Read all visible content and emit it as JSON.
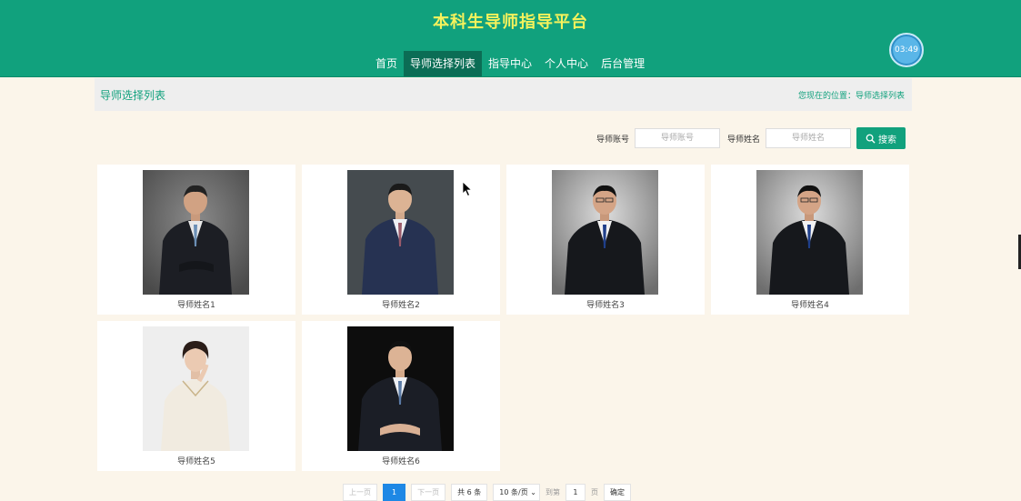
{
  "header": {
    "title": "本科生导师指导平台",
    "nav": [
      "首页",
      "导师选择列表",
      "指导中心",
      "个人中心",
      "后台管理"
    ],
    "active_nav": 1,
    "clock": "03:49"
  },
  "breadcrumb": {
    "title": "导师选择列表",
    "location": "您现在的位置：导师选择列表"
  },
  "search": {
    "account_label": "导师账号",
    "account_placeholder": "导师账号",
    "name_label": "导师姓名",
    "name_placeholder": "导师姓名",
    "button_label": "搜索"
  },
  "mentors": [
    {
      "name": "导师姓名1"
    },
    {
      "name": "导师姓名2"
    },
    {
      "name": "导师姓名3"
    },
    {
      "name": "导师姓名4"
    },
    {
      "name": "导师姓名5"
    },
    {
      "name": "导师姓名6"
    }
  ],
  "pagination": {
    "prev": "上一页",
    "current": "1",
    "next": "下一页",
    "total": "共 6 条",
    "page_size": "10 条/页",
    "jump_label": "到第",
    "jump_value": "1",
    "page_unit": "页",
    "confirm": "确定"
  },
  "colors": {
    "brand": "#11a17d",
    "title": "#f5f25c",
    "page_bg": "#fbf5ea",
    "pager_active": "#1e88e5"
  }
}
